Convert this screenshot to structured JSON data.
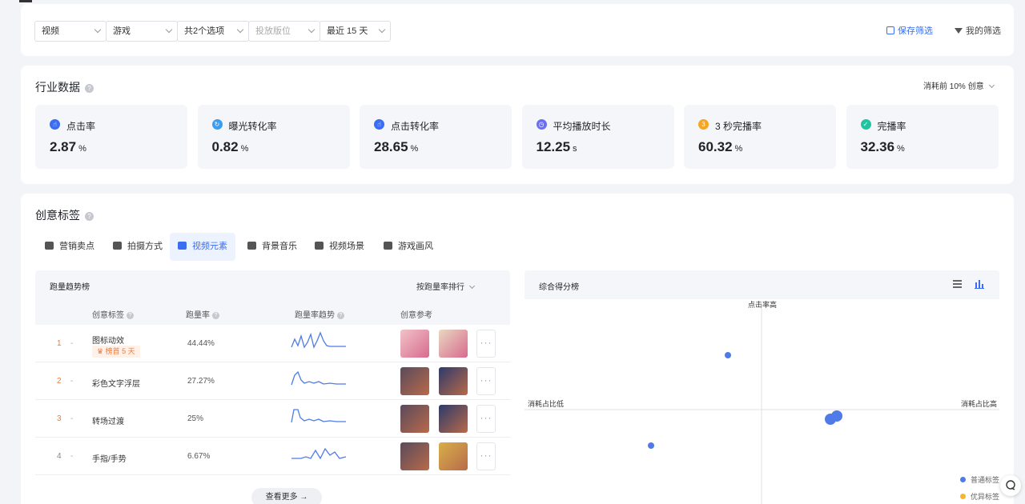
{
  "filters": {
    "media": "视频",
    "industry": "游戏",
    "options": "共2个选项",
    "placement_placeholder": "投放版位",
    "period": "最近 15 天",
    "save_filter": "保存筛选",
    "my_filter": "我的筛选"
  },
  "industry": {
    "title": "行业数据",
    "help": "?",
    "scope": "消耗前 10% 创意",
    "metrics": [
      {
        "label": "点击率",
        "value": "2.87",
        "unit": "%",
        "icon": "hand-pointer-icon",
        "color": "#3a6df0"
      },
      {
        "label": "曝光转化率",
        "value": "0.82",
        "unit": "%",
        "icon": "refresh-icon",
        "color": "#3a9df0"
      },
      {
        "label": "点击转化率",
        "value": "28.65",
        "unit": "%",
        "icon": "hand-pointer-icon",
        "color": "#3a6df0"
      },
      {
        "label": "平均播放时长",
        "value": "12.25",
        "unit": "s",
        "icon": "clock-icon",
        "color": "#6b6ff0"
      },
      {
        "label": "3 秒完播率",
        "value": "60.32",
        "unit": "%",
        "icon": "three-icon",
        "color": "#f5a623"
      },
      {
        "label": "完播率",
        "value": "32.36",
        "unit": "%",
        "icon": "check-circle-icon",
        "color": "#25c2a0"
      }
    ]
  },
  "creative": {
    "title": "创意标签",
    "help": "?",
    "tabs": [
      {
        "label": "营销卖点",
        "icon": "tag-icon"
      },
      {
        "label": "拍摄方式",
        "icon": "camera-icon"
      },
      {
        "label": "视频元素",
        "icon": "layers-icon"
      },
      {
        "label": "背景音乐",
        "icon": "music-icon"
      },
      {
        "label": "视频场景",
        "icon": "building-icon"
      },
      {
        "label": "游戏画风",
        "icon": "palette-icon"
      }
    ],
    "rank": {
      "title": "跑量趋势榜",
      "sort": "按跑量率排行",
      "columns": {
        "tag": "创意标签",
        "rate": "跑量率",
        "trend": "跑量率趋势",
        "ref": "创意参考"
      },
      "rows": [
        {
          "rank": "1",
          "dash": "-",
          "name": "图标动效",
          "badge": "榜首 5 天",
          "rate": "44.44%"
        },
        {
          "rank": "2",
          "dash": "-",
          "name": "彩色文字浮层",
          "rate": "27.27%"
        },
        {
          "rank": "3",
          "dash": "-",
          "name": "转场过渡",
          "rate": "25%"
        },
        {
          "rank": "4",
          "dash": "-",
          "name": "手指/手势",
          "rate": "6.67%"
        }
      ],
      "more": "···",
      "view_more": "查看更多 →"
    },
    "score": {
      "title": "综合得分榜",
      "axis_top": "点击率高",
      "axis_left": "消耗占比低",
      "axis_right": "消耗占比高",
      "legend": [
        {
          "label": "普通标签",
          "color": "#4f7be8"
        },
        {
          "label": "优异标签",
          "color": "#f5b731"
        }
      ]
    }
  },
  "colors": {
    "accent": "#3a6df0",
    "rank_top": "#f07a3a",
    "rank_normal": "#888888"
  }
}
